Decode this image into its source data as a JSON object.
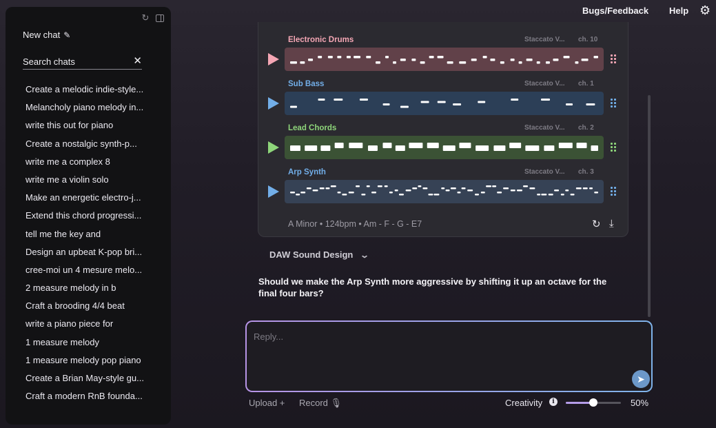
{
  "sidebar": {
    "new_chat_label": "New chat",
    "search_placeholder": "Search chats",
    "chats": [
      "Create a melodic indie-style...",
      "Melancholy piano melody in...",
      "write this out for piano",
      "Create a nostalgic synth-p...",
      "write me a complex 8",
      "write me a violin solo",
      "Make an energetic electro-j...",
      "Extend this chord progressi...",
      "tell me the key and",
      "Design an upbeat K-pop bri...",
      "cree-moi un 4 mesure melo...",
      "2 measure melody in b",
      "Craft a brooding 4/4 beat",
      "write a piano piece for",
      "1 measure melody",
      "1 measure melody pop piano",
      "Create a Brian May-style gu...",
      "Craft a modern RnB founda..."
    ]
  },
  "nav": {
    "bugs_label": "Bugs/Feedback",
    "help_label": "Help"
  },
  "tracks": [
    {
      "name": "Electronic Drums",
      "instrument": "Staccato V...",
      "channel": "ch. 10",
      "color": "#f4a6b4",
      "roll_color": "#614149"
    },
    {
      "name": "Sub Bass",
      "instrument": "Staccato V...",
      "channel": "ch. 1",
      "color": "#72aee8",
      "roll_color": "#2c3f57"
    },
    {
      "name": "Lead Chords",
      "instrument": "Staccato V...",
      "channel": "ch. 2",
      "color": "#8ed57a",
      "roll_color": "#3b5235"
    },
    {
      "name": "Arp Synth",
      "instrument": "Staccato V...",
      "channel": "ch. 3",
      "color": "#72aee8",
      "roll_color": "#364255"
    }
  ],
  "card_footer": "A Minor • 124bpm • Am - F - G - E7",
  "expander_label": "DAW Sound Design",
  "question": "Should we make the Arp Synth more aggressive by shifting it up an octave for the final four bars?",
  "reply": {
    "placeholder": "Reply..."
  },
  "bottom": {
    "upload_label": "Upload +",
    "record_label": "Record 🎙",
    "creativity_label": "Creativity",
    "creativity_value": 0.5,
    "creativity_display": "50%"
  }
}
